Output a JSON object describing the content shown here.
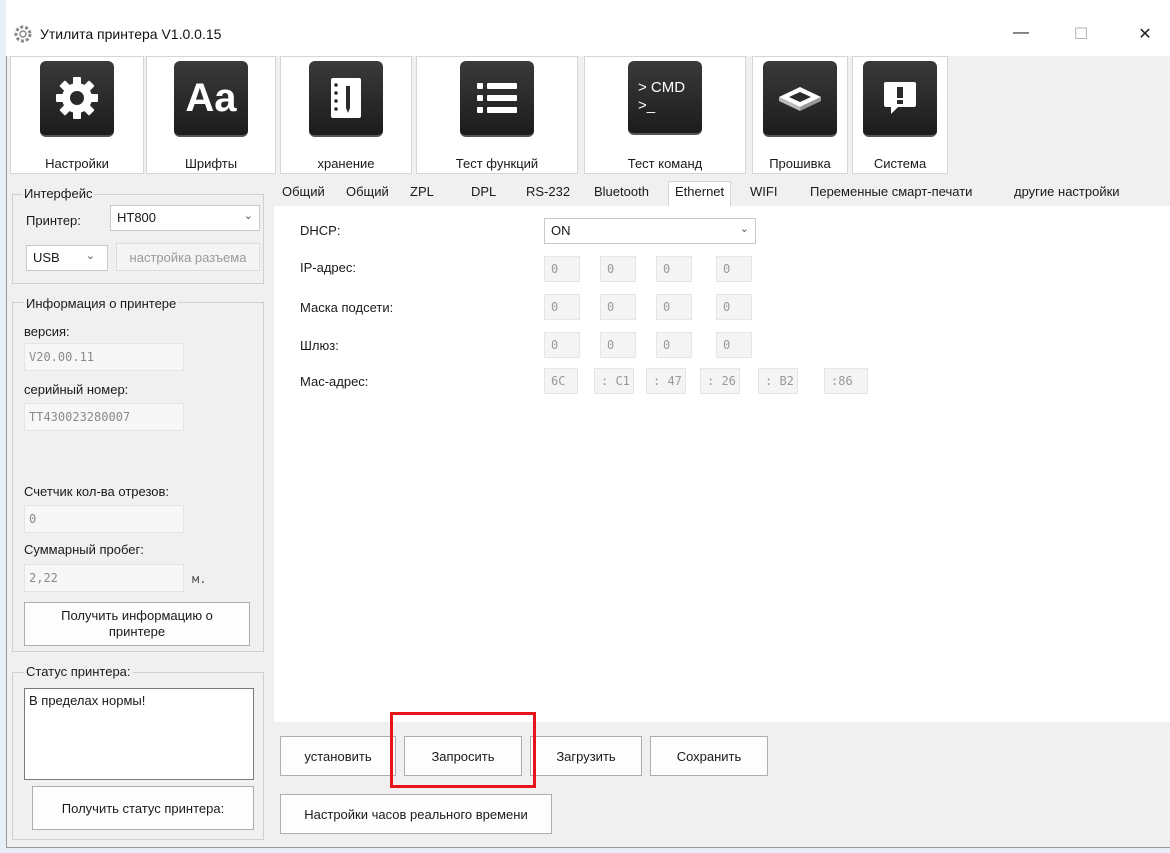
{
  "window": {
    "title": "Утилита принтера  V1.0.0.15",
    "controls": {
      "minimize": "—",
      "maximize": "☐",
      "close": "✕"
    }
  },
  "toolbar": {
    "settings_label": "Настройки",
    "fonts_label": "Шрифты",
    "fonts_icon_text": "Aa",
    "storage_label": "хранение",
    "function_test_label": "Тест функций",
    "command_test_label": "Тест команд",
    "cmd_icon_line1": "> CMD",
    "cmd_icon_line2": ">_",
    "firmware_label": "Прошивка",
    "system_label": "Система"
  },
  "left_panel": {
    "interface_title": "Интерфейс",
    "printer_label": "Принтер:",
    "printer_value": "HT800",
    "port_value": "USB",
    "port_settings_button": "настройка разъема",
    "info_title": "Информация о принтере",
    "version_label": "версия:",
    "version_value": "V20.00.11",
    "serial_label": "серийный номер:",
    "serial_value": "TT430023280007",
    "cut_counter_label": "Счетчик кол-ва отрезов:",
    "cut_counter_value": "0",
    "mileage_label": "Суммарный пробег:",
    "mileage_value": "2,22",
    "mileage_unit": "м.",
    "get_info_button": "Получить информацию о принтере",
    "status_title": "Статус принтера:",
    "status_text": "В пределах нормы!",
    "get_status_button": "Получить статус принтера:"
  },
  "tabs": [
    "Общий",
    "Общий",
    "ZPL",
    "DPL",
    "RS-232",
    "Bluetooth",
    "Ethernet",
    "WIFI",
    "Переменные смарт-печати",
    "другие настройки"
  ],
  "active_tab": "Ethernet",
  "ethernet": {
    "dhcp_label": "DHCP:",
    "dhcp_value": "ON",
    "ip_label": "IP-адрес:",
    "ip_value": [
      "0",
      "0",
      "0",
      "0"
    ],
    "mask_label": "Маска подсети:",
    "mask_value": [
      "0",
      "0",
      "0",
      "0"
    ],
    "gateway_label": "Шлюз:",
    "gateway_value": [
      "0",
      "0",
      "0",
      "0"
    ],
    "mac_label": "Мас-адрес:",
    "mac_value": [
      "6C",
      ": C1",
      ": 47",
      ": 26",
      ": B2",
      ":86"
    ]
  },
  "actions": {
    "set_button": "установить",
    "query_button": "Запросить",
    "load_button": "Загрузить",
    "save_button": "Сохранить",
    "rtc_button": "Настройки часов реального времени"
  },
  "colors": {
    "highlight": "#e8141c",
    "tool_icon_bg": "#1c1c1c"
  }
}
